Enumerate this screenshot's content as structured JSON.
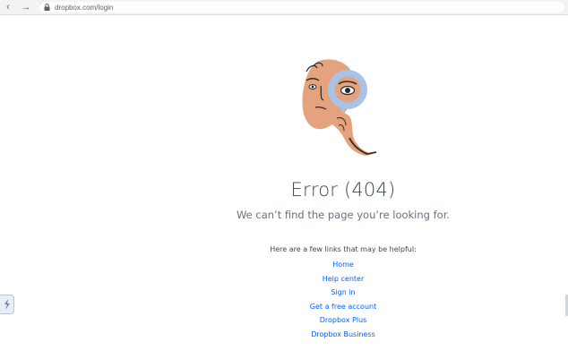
{
  "browser": {
    "back_icon": "back-arrow-icon",
    "forward_icon": "forward-arrow-icon",
    "reload_icon": "reload-icon",
    "lock_icon": "lock-icon",
    "url": "dropbox.com/login"
  },
  "error": {
    "title": "Error (404)",
    "subtitle": "We can’t find the page you’re looking for."
  },
  "helpful": {
    "intro": "Here are a few links that may be helpful:",
    "links": [
      {
        "label": "Home"
      },
      {
        "label": "Help center"
      },
      {
        "label": "Sign in"
      },
      {
        "label": "Get a free account"
      },
      {
        "label": "Dropbox Plus"
      },
      {
        "label": "Dropbox Business"
      }
    ]
  },
  "colors": {
    "link": "#0061fe",
    "title": "#3d464d",
    "subtitle": "#637282",
    "face": "#e4a27d",
    "lens": "#a9c3e8"
  }
}
